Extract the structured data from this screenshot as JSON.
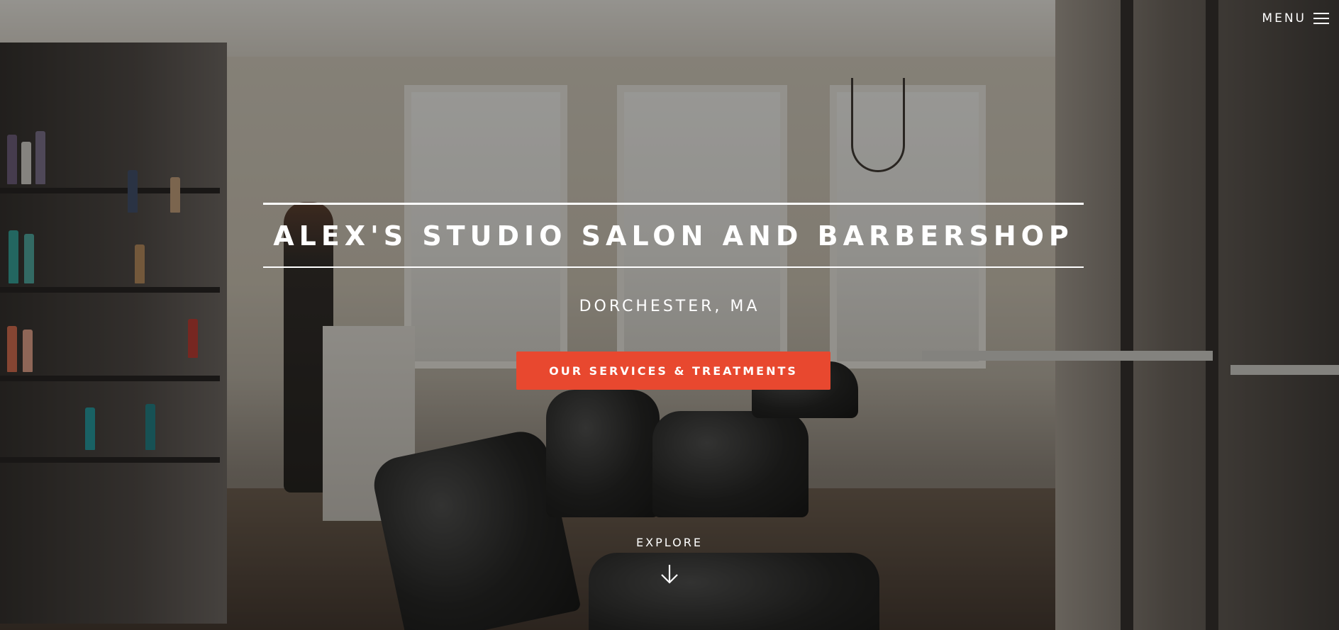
{
  "header": {
    "menu_label": "MENU",
    "menu_icon": "hamburger-icon"
  },
  "hero": {
    "title": "ALEX'S STUDIO SALON AND BARBERSHOP",
    "location": "DORCHESTER, MA",
    "cta_label": "OUR SERVICES & TREATMENTS",
    "explore_label": "EXPLORE",
    "explore_icon": "arrow-down-icon"
  },
  "colors": {
    "accent": "#e8482f",
    "text": "#ffffff",
    "overlay": "rgba(20,18,16,0.42)"
  }
}
